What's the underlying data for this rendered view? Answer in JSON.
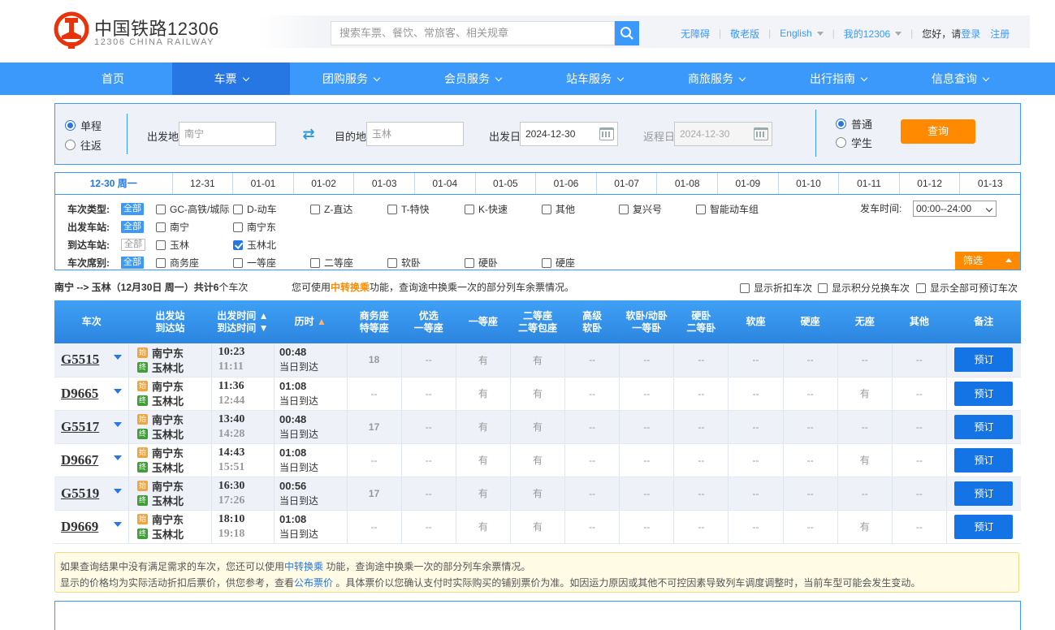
{
  "header": {
    "logo_title": "中国铁路12306",
    "logo_sub": "12306 CHINA RAILWAY",
    "search_placeholder": "搜索车票、餐饮、常旅客、相关规章",
    "links": {
      "accessible": "无障碍",
      "elderly": "敬老版",
      "english": "English",
      "my12306": "我的12306",
      "greeting": "您好，请",
      "login": "登录",
      "register": "注册"
    }
  },
  "nav": [
    "首页",
    "车票",
    "团购服务",
    "会员服务",
    "站车服务",
    "商旅服务",
    "出行指南",
    "信息查询"
  ],
  "query": {
    "trip_oneway": "单程",
    "trip_round": "往返",
    "from_label": "出发地",
    "from_value": "南宁",
    "to_label": "目的地",
    "to_value": "玉林",
    "date_label": "出发日",
    "date_value": "2024-12-30",
    "return_label": "返程日",
    "return_value": "2024-12-30",
    "ticket_normal": "普通",
    "ticket_student": "学生",
    "search_button": "查询"
  },
  "date_tabs": [
    "12-30 周一",
    "12-31",
    "01-01",
    "01-02",
    "01-03",
    "01-04",
    "01-05",
    "01-06",
    "01-07",
    "01-08",
    "01-09",
    "01-10",
    "01-11",
    "01-12",
    "01-13"
  ],
  "filters": {
    "type_title": "车次类型:",
    "from_title": "出发车站:",
    "to_title": "到达车站:",
    "seat_title": "车次席别:",
    "all": "全部",
    "types": [
      "GC-高铁/城际",
      "D-动车",
      "Z-直达",
      "T-特快",
      "K-快速",
      "其他",
      "复兴号",
      "智能动车组"
    ],
    "from_stations": [
      "南宁",
      "南宁东"
    ],
    "to_stations": [
      "玉林",
      "玉林北"
    ],
    "seats": [
      "商务座",
      "一等座",
      "二等座",
      "软卧",
      "硬卧",
      "硬座"
    ],
    "time_label": "发车时间:",
    "time_value": "00:00--24:00",
    "filter_button": "筛选"
  },
  "summary": {
    "route": "南宁 --> 玉林（12月30日  周一）共计",
    "count": "6",
    "suffix": "个车次",
    "tip_pre": "您可使用",
    "tip_link": "中转换乘",
    "tip_post": "功能，查询途中换乘一次的部分列车余票情况。",
    "opt1": "显示折扣车次",
    "opt2": "显示积分兑换车次",
    "opt3": "显示全部可预订车次"
  },
  "table": {
    "headers": {
      "train": "车次",
      "station1": "出发站",
      "station2": "到达站",
      "time1": "出发时间",
      "time2": "到达时间",
      "duration": "历时",
      "business1": "商务座",
      "business2": "特等座",
      "premium1": "优选",
      "premium2": "一等座",
      "first": "一等座",
      "second1": "二等座",
      "second2": "二等包座",
      "advsoft1": "高级",
      "advsoft2": "软卧",
      "soft1": "软卧/动卧",
      "soft2": "一等卧",
      "hard1": "硬卧",
      "hard2": "二等卧",
      "softseat": "软座",
      "hardseat": "硬座",
      "noseat": "无座",
      "other": "其他",
      "remark": "备注"
    },
    "start_badge": "始",
    "end_badge": "终",
    "arrive_today": "当日到达",
    "book": "预订",
    "rows": [
      {
        "no": "G5515",
        "from": "南宁东",
        "to": "玉林北",
        "dep": "10:23",
        "arr": "11:11",
        "dur": "00:48",
        "seats": [
          "18",
          "--",
          "有",
          "有",
          "--",
          "--",
          "--",
          "--",
          "--",
          "--",
          "--"
        ]
      },
      {
        "no": "D9665",
        "from": "南宁东",
        "to": "玉林北",
        "dep": "11:36",
        "arr": "12:44",
        "dur": "01:08",
        "seats": [
          "--",
          "--",
          "有",
          "有",
          "--",
          "--",
          "--",
          "--",
          "--",
          "有",
          "--"
        ]
      },
      {
        "no": "G5517",
        "from": "南宁东",
        "to": "玉林北",
        "dep": "13:40",
        "arr": "14:28",
        "dur": "00:48",
        "seats": [
          "17",
          "--",
          "有",
          "有",
          "--",
          "--",
          "--",
          "--",
          "--",
          "--",
          "--"
        ]
      },
      {
        "no": "D9667",
        "from": "南宁东",
        "to": "玉林北",
        "dep": "14:43",
        "arr": "15:51",
        "dur": "01:08",
        "seats": [
          "--",
          "--",
          "有",
          "有",
          "--",
          "--",
          "--",
          "--",
          "--",
          "有",
          "--"
        ]
      },
      {
        "no": "G5519",
        "from": "南宁东",
        "to": "玉林北",
        "dep": "16:30",
        "arr": "17:26",
        "dur": "00:56",
        "seats": [
          "17",
          "--",
          "有",
          "有",
          "--",
          "--",
          "--",
          "--",
          "--",
          "--",
          "--"
        ]
      },
      {
        "no": "D9669",
        "from": "南宁东",
        "to": "玉林北",
        "dep": "18:10",
        "arr": "19:18",
        "dur": "01:08",
        "seats": [
          "--",
          "--",
          "有",
          "有",
          "--",
          "--",
          "--",
          "--",
          "--",
          "有",
          "--"
        ]
      }
    ]
  },
  "notice": {
    "line1_pre": "如果查询结果中没有满足需求的车次，您还可以使用",
    "line1_link": "中转换乘",
    "line1_post": " 功能，查询途中换乘一次的部分列车余票情况。",
    "line2_pre": "显示的价格均为实际活动折扣后票价，供您参考，查看",
    "line2_link": "公布票价",
    "line2_post": " 。具体票价以您确认支付时实际购买的铺别票价为准。如因运力原因或其他不可控因素导致列车调度调整时，当前车型可能会发生变动。"
  },
  "colors": {
    "primary": "#3b99fc",
    "nav_active": "#2676e3",
    "accent": "#ff8a00",
    "available": "#2b9b2b",
    "book": "#1474e6"
  }
}
